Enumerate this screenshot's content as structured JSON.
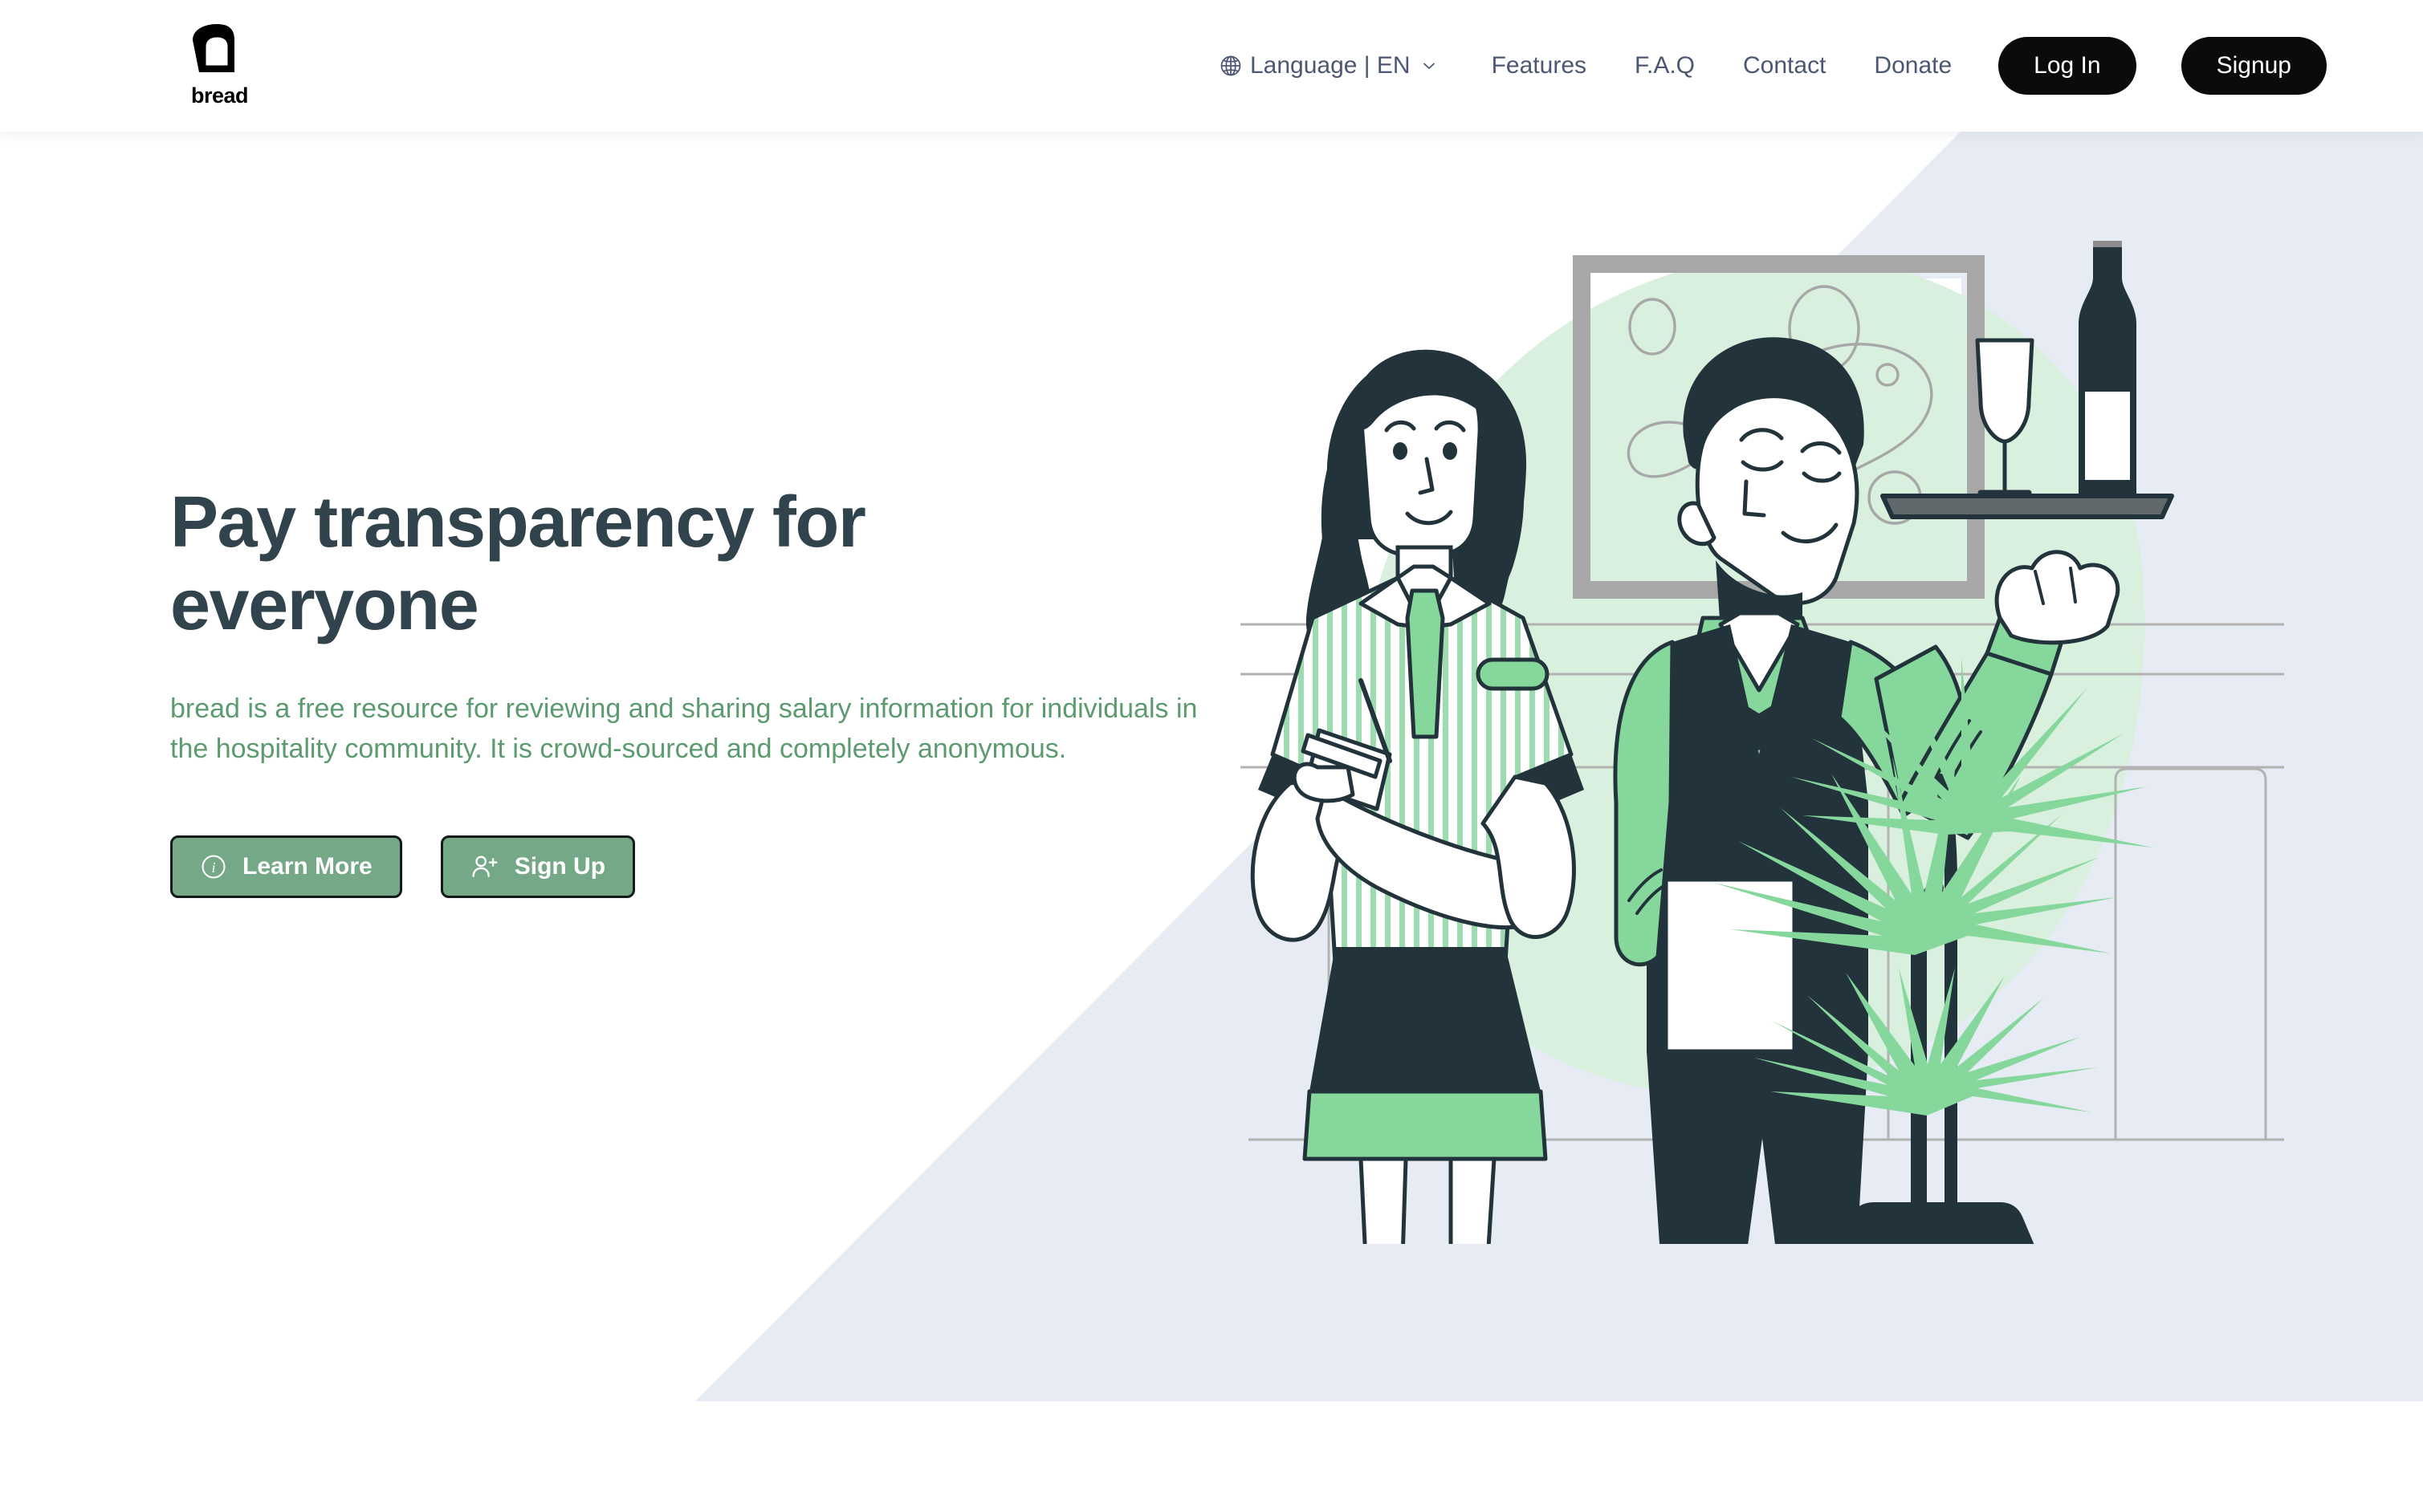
{
  "brand": {
    "name": "bread",
    "logo_icon": "bread-loaf-icon"
  },
  "header": {
    "language": {
      "icon": "globe-icon",
      "label": "Language | EN",
      "chevron_icon": "chevron-down-icon"
    },
    "nav_links": [
      {
        "label": "Features"
      },
      {
        "label": "F.A.Q"
      },
      {
        "label": "Contact"
      },
      {
        "label": "Donate"
      }
    ],
    "login_label": "Log In",
    "signup_label": "Signup"
  },
  "hero": {
    "title": "Pay transparency for everyone",
    "subtitle": "bread is a free resource for reviewing and sharing salary information for individuals in the hospitality community. It is crowd-sourced and completely anonymous.",
    "primary_button": {
      "label": "Learn More",
      "icon": "info-circle-icon"
    },
    "secondary_button": {
      "label": "Sign Up",
      "icon": "user-plus-icon"
    },
    "illustration": "hospitality-waitress-and-waiter-illustration"
  },
  "colors": {
    "page_background": "#ffffff",
    "hero_panel": "#e7ebf3",
    "heading_text": "#31434c",
    "body_text_green": "#5c9a6f",
    "nav_text": "#4c5773",
    "button_green": "#74a886",
    "button_dark": "#0b0b0e",
    "illustration_ink": "#22333b",
    "illustration_green": "#86d79c",
    "illustration_green_pale": "#d9f0df",
    "illustration_gray": "#a7a7a7"
  }
}
